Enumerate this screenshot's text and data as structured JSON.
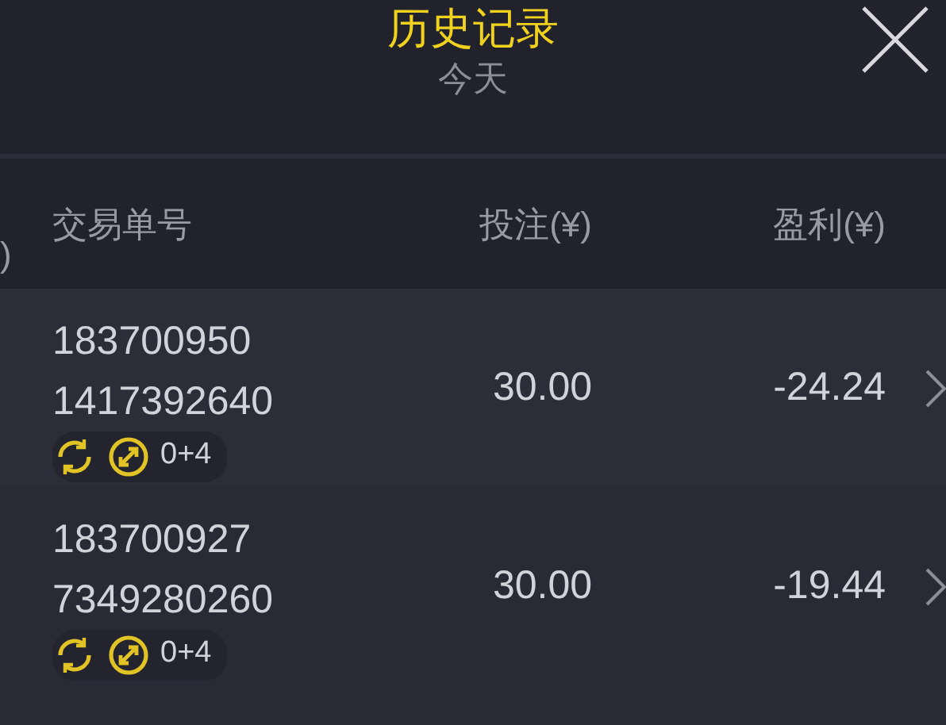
{
  "header": {
    "title": "历史记录",
    "subtitle": "今天"
  },
  "table": {
    "columns": [
      ")",
      "交易单号",
      "投注(¥)",
      "盈利(¥)"
    ],
    "rows": [
      {
        "order_lines": [
          "183700950",
          "1417392640"
        ],
        "tag": "0+4",
        "bet": "30.00",
        "profit": "-24.24"
      },
      {
        "order_lines": [
          "183700927",
          "7349280260"
        ],
        "tag": "0+4",
        "bet": "30.00",
        "profit": "-19.44"
      }
    ]
  }
}
